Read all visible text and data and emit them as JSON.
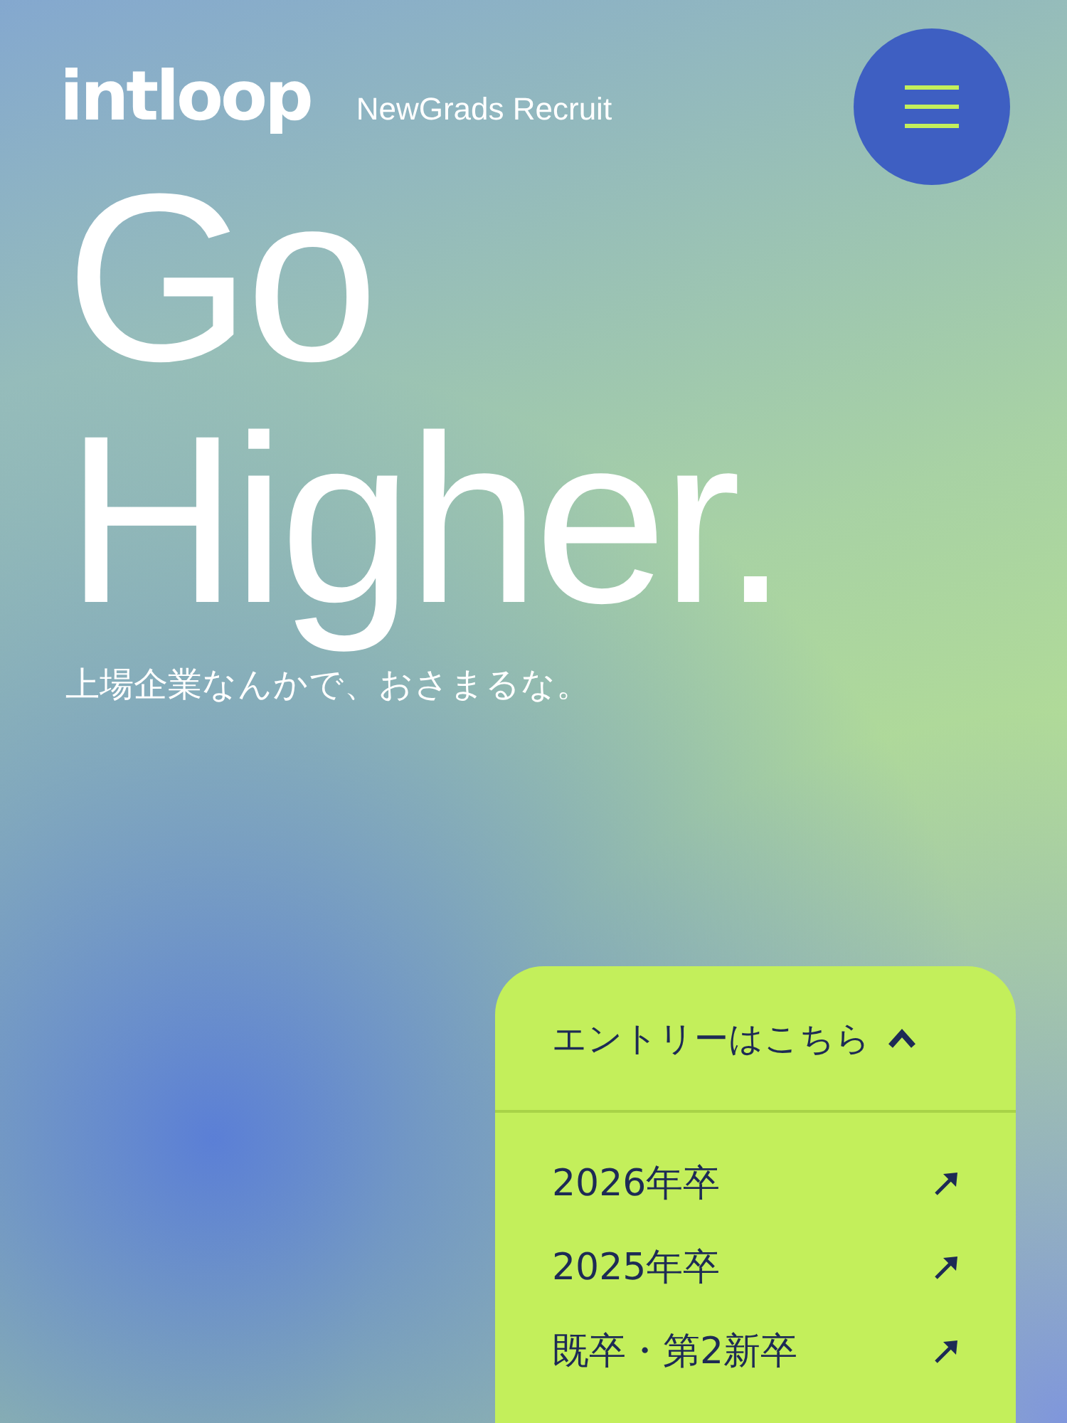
{
  "header": {
    "logo": "intloop",
    "subtitle": "NewGrads Recruit"
  },
  "hero": {
    "lines": [
      "Go",
      "Higher."
    ],
    "tagline": "上場企業なんかで、おさまるな。"
  },
  "entry": {
    "title": "エントリーはこちら",
    "expanded": true,
    "items": [
      {
        "label": "2026年卒"
      },
      {
        "label": "2025年卒"
      },
      {
        "label": "既卒・第2新卒"
      }
    ]
  }
}
